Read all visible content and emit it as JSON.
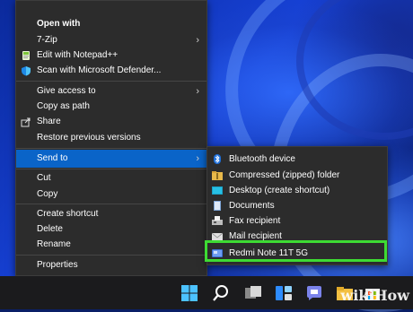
{
  "context_menu": {
    "items": [
      {
        "label": "Open with",
        "bold": true
      },
      {
        "label": "7-Zip",
        "submenu": true
      },
      {
        "label": "Edit with Notepad++",
        "icon": "notepad-plus-plus-icon"
      },
      {
        "label": "Scan with Microsoft Defender...",
        "icon": "defender-shield-icon"
      },
      {
        "label": "Give access to",
        "submenu": true
      },
      {
        "label": "Copy as path"
      },
      {
        "label": "Share",
        "icon": "share-icon"
      },
      {
        "label": "Restore previous versions"
      },
      {
        "label": "Send to",
        "submenu": true,
        "selected": true
      },
      {
        "label": "Cut"
      },
      {
        "label": "Copy"
      },
      {
        "label": "Create shortcut"
      },
      {
        "label": "Delete"
      },
      {
        "label": "Rename"
      },
      {
        "label": "Properties"
      }
    ],
    "submenu_chevron": "›"
  },
  "send_to_menu": {
    "items": [
      {
        "label": "Bluetooth device",
        "icon": "bluetooth-icon"
      },
      {
        "label": "Compressed (zipped) folder",
        "icon": "zip-folder-icon"
      },
      {
        "label": "Desktop (create shortcut)",
        "icon": "desktop-icon"
      },
      {
        "label": "Documents",
        "icon": "documents-icon"
      },
      {
        "label": "Fax recipient",
        "icon": "fax-icon"
      },
      {
        "label": "Mail recipient",
        "icon": "mail-icon"
      },
      {
        "label": "Redmi Note 11T 5G",
        "icon": "phone-device-icon",
        "highlighted": true
      }
    ]
  },
  "colors": {
    "menu_bg": "#2c2c2c",
    "selected_bg": "#0a64c8",
    "highlight_box": "#3ddb33",
    "taskbar_bg": "#1b1b1d"
  },
  "taskbar": {
    "icons": [
      "windows-start-icon",
      "search-icon",
      "task-view-icon",
      "widgets-icon",
      "teams-chat-icon",
      "file-explorer-icon",
      "store-icon"
    ]
  },
  "watermark": "wikiHow"
}
